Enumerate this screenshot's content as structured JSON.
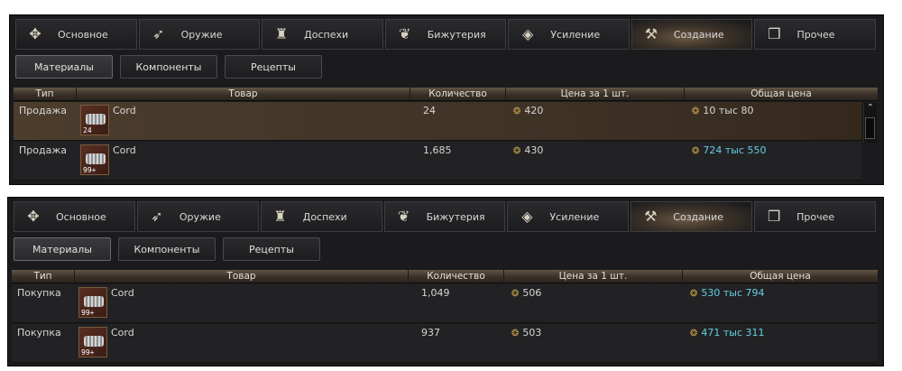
{
  "category_tabs": [
    {
      "label": "Основное",
      "icon": "gear-icon",
      "glyph": "✥"
    },
    {
      "label": "Оружие",
      "icon": "bow-icon",
      "glyph": "➶"
    },
    {
      "label": "Доспехи",
      "icon": "helmet-icon",
      "glyph": "♜"
    },
    {
      "label": "Бижутерия",
      "icon": "jewelry-icon",
      "glyph": "❦"
    },
    {
      "label": "Усиление",
      "icon": "crystal-icon",
      "glyph": "◈"
    },
    {
      "label": "Создание",
      "icon": "anvil-icon",
      "glyph": "⚒",
      "active": true
    },
    {
      "label": "Прочее",
      "icon": "box-icon",
      "glyph": "❒"
    }
  ],
  "sub_tabs": [
    "Материалы",
    "Компоненты",
    "Рецепты"
  ],
  "columns": [
    "Тип",
    "Товар",
    "Количество",
    "Цена за 1 шт.",
    "Общая цена"
  ],
  "coin_icon": "adena-coin-icon",
  "colors": {
    "sell": "#6d9bf0",
    "buy": "#e8514d",
    "total_highlight": "#63cfe3"
  },
  "panels": [
    {
      "name": "sell-listings",
      "rows": [
        {
          "type": "Продажа",
          "item": "Cord",
          "stack": "24",
          "qty": "24",
          "price": "420",
          "total": "10 тыс 80",
          "highlight": true
        },
        {
          "type": "Продажа",
          "item": "Cord",
          "stack": "99+",
          "qty": "1,685",
          "price": "430",
          "total": "724 тыс 550"
        }
      ]
    },
    {
      "name": "buy-listings",
      "rows": [
        {
          "type": "Покупка",
          "item": "Cord",
          "stack": "99+",
          "qty": "1,049",
          "price": "506",
          "total": "530 тыс 794"
        },
        {
          "type": "Покупка",
          "item": "Cord",
          "stack": "99+",
          "qty": "937",
          "price": "503",
          "total": "471 тыс 311"
        }
      ]
    }
  ]
}
